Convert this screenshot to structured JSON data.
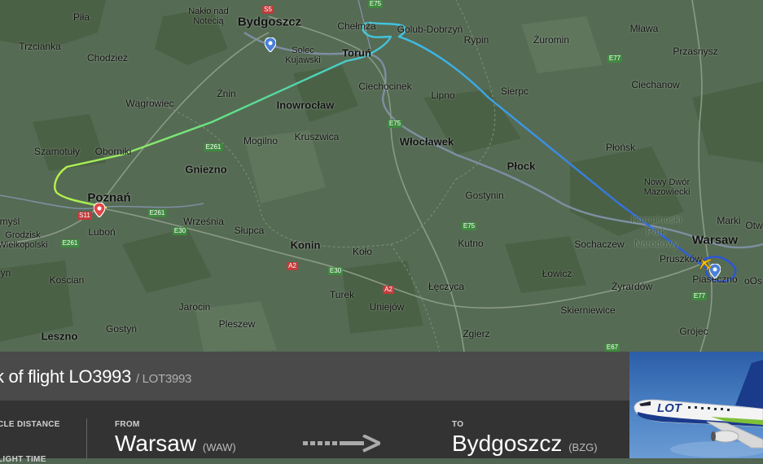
{
  "map": {
    "places": [
      {
        "name": "Piła",
        "style": "normal"
      },
      {
        "name": "Nakło nad\nNotecią",
        "style": "normal"
      },
      {
        "name": "Bydgoszcz",
        "style": "big"
      },
      {
        "name": "Chełmża",
        "style": "normal"
      },
      {
        "name": "Golub-Dobrzyń",
        "style": "normal"
      },
      {
        "name": "Rypin",
        "style": "normal"
      },
      {
        "name": "Żuromin",
        "style": "normal"
      },
      {
        "name": "Mława",
        "style": "normal"
      },
      {
        "name": "Przasnysz",
        "style": "normal"
      },
      {
        "name": "Trzcianka",
        "style": "normal"
      },
      {
        "name": "Chodzież",
        "style": "normal"
      },
      {
        "name": "Solec\nKujawski",
        "style": "normal"
      },
      {
        "name": "Toruń",
        "style": "city"
      },
      {
        "name": "Ciechocinek",
        "style": "normal"
      },
      {
        "name": "Lipno",
        "style": "normal"
      },
      {
        "name": "Sierpc",
        "style": "normal"
      },
      {
        "name": "Ciechanow",
        "style": "normal"
      },
      {
        "name": "Wągrowiec",
        "style": "normal"
      },
      {
        "name": "Żnin",
        "style": "normal"
      },
      {
        "name": "Inowrocław",
        "style": "city"
      },
      {
        "name": "Mogilno",
        "style": "normal"
      },
      {
        "name": "Kruszwica",
        "style": "normal"
      },
      {
        "name": "Włocławek",
        "style": "city"
      },
      {
        "name": "Płońsk",
        "style": "normal"
      },
      {
        "name": "Szamotuły",
        "style": "normal"
      },
      {
        "name": "Oborniki",
        "style": "normal"
      },
      {
        "name": "Gniezno",
        "style": "city"
      },
      {
        "name": "Płock",
        "style": "city"
      },
      {
        "name": "Nowy Dwór\nMazowiecki",
        "style": "normal"
      },
      {
        "name": "Poznań",
        "style": "big"
      },
      {
        "name": "Gostynin",
        "style": "normal"
      },
      {
        "name": "Kampinoski\nPark\nNarodowy",
        "style": "park"
      },
      {
        "name": "Marki",
        "style": "normal"
      },
      {
        "name": "Września",
        "style": "normal"
      },
      {
        "name": "Słupca",
        "style": "normal"
      },
      {
        "name": "Konin",
        "style": "city"
      },
      {
        "name": "Kutno",
        "style": "normal"
      },
      {
        "name": "Sochaczew",
        "style": "normal"
      },
      {
        "name": "Warsaw",
        "style": "big"
      },
      {
        "name": "Grodzisk\nWielkopolski",
        "style": "normal"
      },
      {
        "name": "Luboń",
        "style": "normal"
      },
      {
        "name": "Koło",
        "style": "normal"
      },
      {
        "name": "Pruszków",
        "style": "normal"
      },
      {
        "name": "Łowicz",
        "style": "normal"
      },
      {
        "name": "Piaseczno",
        "style": "normal"
      },
      {
        "name": "Kościan",
        "style": "normal"
      },
      {
        "name": "Turek",
        "style": "normal"
      },
      {
        "name": "Łęczyca",
        "style": "normal"
      },
      {
        "name": "Żyrardów",
        "style": "normal"
      },
      {
        "name": "Jarocin",
        "style": "normal"
      },
      {
        "name": "Uniejów",
        "style": "normal"
      },
      {
        "name": "Skierniewice",
        "style": "normal"
      },
      {
        "name": "Pleszew",
        "style": "normal"
      },
      {
        "name": "Gostyń",
        "style": "normal"
      },
      {
        "name": "Leszno",
        "style": "city"
      },
      {
        "name": "Zgierz",
        "style": "normal"
      },
      {
        "name": "Grójec",
        "style": "normal"
      },
      {
        "name": "myśl",
        "style": "normal"
      },
      {
        "name": "yn",
        "style": "normal"
      },
      {
        "name": "Otw",
        "style": "normal"
      },
      {
        "name": "oOs",
        "style": "normal"
      }
    ],
    "road_shields": [
      {
        "label": "S5",
        "color": "red"
      },
      {
        "label": "E75",
        "color": "green"
      },
      {
        "label": "E77",
        "color": "green"
      },
      {
        "label": "E75",
        "color": "green"
      },
      {
        "label": "E261",
        "color": "green"
      },
      {
        "label": "S11",
        "color": "red"
      },
      {
        "label": "E261",
        "color": "green"
      },
      {
        "label": "E30",
        "color": "green"
      },
      {
        "label": "E261",
        "color": "green"
      },
      {
        "label": "A2",
        "color": "red"
      },
      {
        "label": "E30",
        "color": "green"
      },
      {
        "label": "E75",
        "color": "green"
      },
      {
        "label": "A2",
        "color": "red"
      },
      {
        "label": "E77",
        "color": "green"
      },
      {
        "label": "E67",
        "color": "green"
      }
    ],
    "track_colors": [
      "#f2ee3a",
      "#b6f24a",
      "#5fe08a",
      "#3ec0e6",
      "#3a8ce6",
      "#2a56d8"
    ]
  },
  "panel": {
    "title": "k of flight LO3993",
    "callsign": "/ LOT3993",
    "circle_distance_label": "CLE DISTANCE",
    "flight_time_label": "LIGHT TIME",
    "from_label": "FROM",
    "from_city": "Warsaw",
    "from_code": "(WAW)",
    "to_label": "TO",
    "to_city": "Bydgoszcz",
    "to_code": "(BZG)"
  },
  "photo": {
    "livery_text": "LOT"
  }
}
